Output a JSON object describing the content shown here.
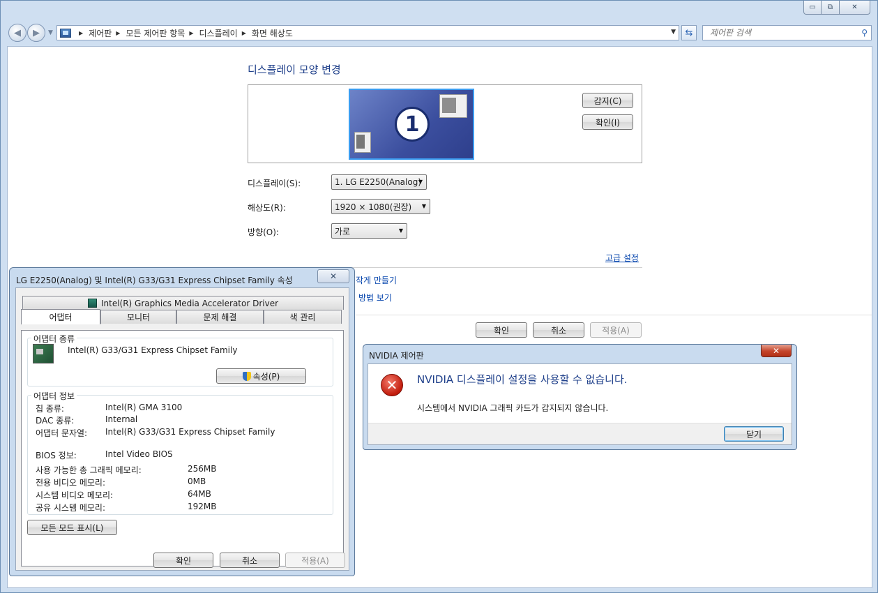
{
  "window_controls": {
    "minimize": "▭",
    "maximize": "⧉",
    "close": "✕"
  },
  "nav": {
    "back": "◀",
    "forward": "▶",
    "breadcrumbs": [
      "제어판",
      "모든 제어판 항목",
      "디스플레이",
      "화면 해상도"
    ],
    "search_placeholder": "제어판 검색"
  },
  "main": {
    "title": "디스플레이 모양 변경",
    "monitor_number": "1",
    "detect_button": "감지(C)",
    "identify_button": "확인(I)",
    "display_label": "디스플레이(S):",
    "display_value": "1. LG E2250(Analog)",
    "resolution_label": "해상도(R):",
    "resolution_value": "1920 × 1080(권장)",
    "orientation_label": "방향(O):",
    "orientation_value": "가로",
    "advanced_link": "고급 설정",
    "link_text_size": "작게 만들기",
    "link_help": "방법 보기",
    "ok_button": "확인",
    "cancel_button": "취소",
    "apply_button": "적용(A)"
  },
  "props_dialog": {
    "title": "LG E2250(Analog) 및 Intel(R) G33/G31 Express Chipset Family 속성",
    "close": "✕",
    "top_tab": "Intel(R) Graphics Media Accelerator Driver",
    "tabs": [
      "어댑터",
      "모니터",
      "문제 해결",
      "색 관리"
    ],
    "adapter_type_legend": "어댑터 종류",
    "adapter_name": "Intel(R) G33/G31 Express Chipset Family",
    "properties_button": "속성(P)",
    "adapter_info_legend": "어댑터 정보",
    "info_rows": [
      {
        "label": "칩 종류:",
        "value": "Intel(R) GMA 3100"
      },
      {
        "label": "DAC 종류:",
        "value": "Internal"
      },
      {
        "label": "어댑터 문자열:",
        "value": "Intel(R) G33/G31 Express Chipset Family"
      },
      {
        "label": "BIOS 정보:",
        "value": "Intel Video BIOS"
      }
    ],
    "memory_rows": [
      {
        "label": "사용 가능한 총 그래픽 메모리:",
        "value": "256MB"
      },
      {
        "label": "전용 비디오 메모리:",
        "value": "0MB"
      },
      {
        "label": "시스템 비디오 메모리:",
        "value": "64MB"
      },
      {
        "label": "공유 시스템 메모리:",
        "value": "192MB"
      }
    ],
    "list_modes_button": "모든 모드 표시(L)",
    "ok_button": "확인",
    "cancel_button": "취소",
    "apply_button": "적용(A)"
  },
  "nvidia_dialog": {
    "title": "NVIDIA 제어판",
    "close": "✕",
    "heading": "NVIDIA 디스플레이 설정을 사용할 수 없습니다.",
    "message": "시스템에서 NVIDIA 그래픽 카드가 감지되지 않습니다.",
    "close_button": "닫기"
  }
}
